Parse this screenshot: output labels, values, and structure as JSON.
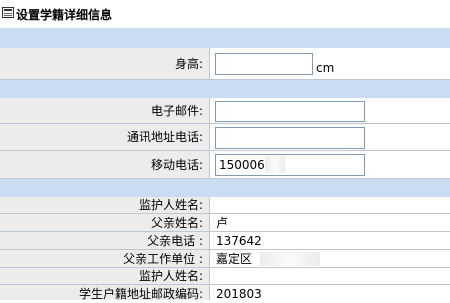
{
  "title": "设置学籍详细信息",
  "height": {
    "label": "身高:",
    "value": "",
    "unit": "cm"
  },
  "contact": {
    "email_label": "电子邮件:",
    "email_value": "",
    "phone_label": "通讯地址电话:",
    "phone_value": "",
    "mobile_label": "移动电话:",
    "mobile_value": "150006"
  },
  "guardian": {
    "guardian1_label": "监护人姓名:",
    "guardian1_value": "",
    "father_name_label": "父亲姓名:",
    "father_name_value": "卢",
    "father_phone_label": "父亲电话 :",
    "father_phone_value": "137642",
    "father_work_label": "父亲工作单位 :",
    "father_work_value": "嘉定区",
    "guardian2_label": "监护人姓名:",
    "guardian2_value": "",
    "postcode_label": "学生户籍地址邮政编码:",
    "postcode_value": "201803"
  }
}
